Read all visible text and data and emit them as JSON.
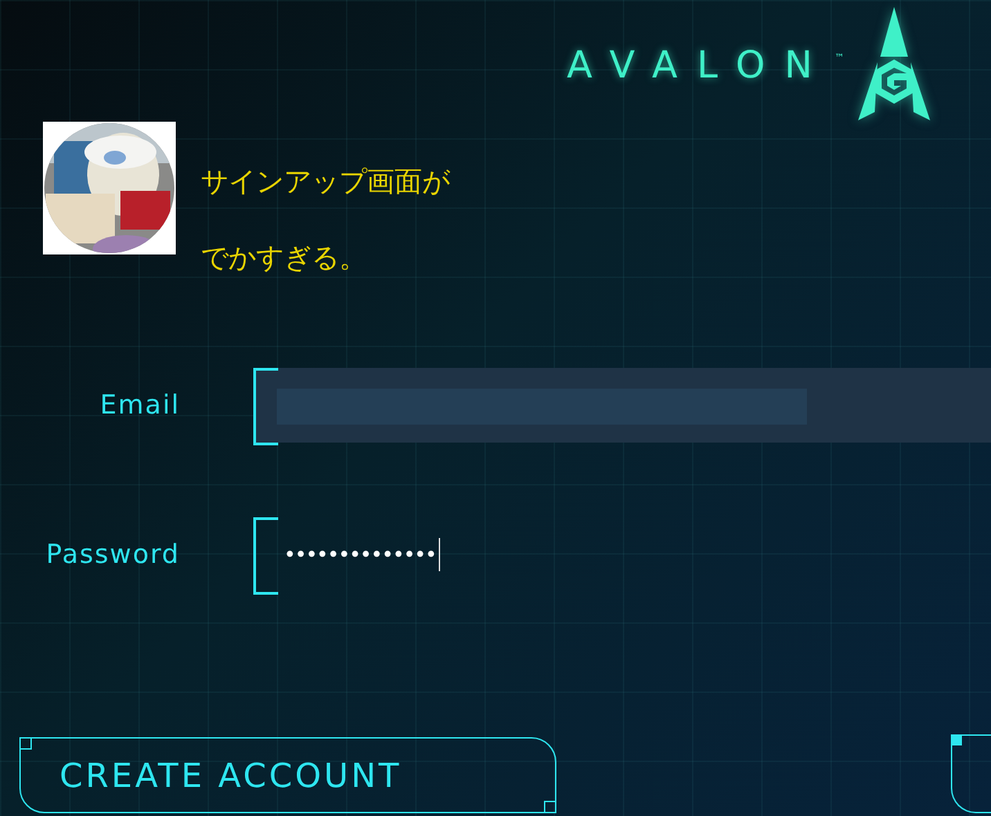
{
  "logo": {
    "text": "AVALON",
    "trademark": "™"
  },
  "post": {
    "lines": [
      "サインアップ画面が",
      "でかすぎる。"
    ]
  },
  "form": {
    "fields": [
      {
        "label": "Email",
        "highlighted": true,
        "focused": false
      },
      {
        "label": "Password",
        "value": "••••••••••••••",
        "highlighted": false,
        "focused": true
      }
    ]
  },
  "buttons": [
    {
      "kind": "full",
      "label": "CREATE ACCOUNT"
    },
    {
      "kind": "cut_off"
    }
  ]
}
